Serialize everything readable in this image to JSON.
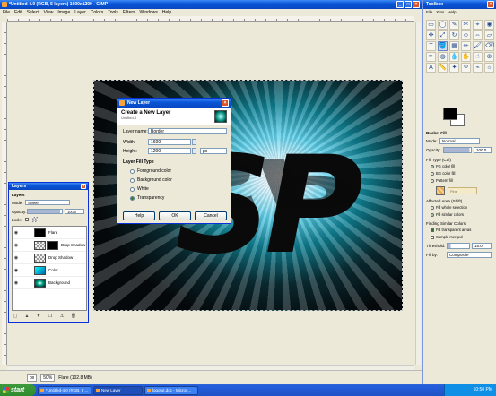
{
  "image_window": {
    "title": "*Untitled-4.0 (RGB, 5 layers) 1600x1200 - GIMP",
    "menu": [
      "File",
      "Edit",
      "Select",
      "View",
      "Image",
      "Layer",
      "Colors",
      "Tools",
      "Filters",
      "Windows",
      "Help"
    ],
    "status_unit": "px",
    "zoom": "50%",
    "status_text": "Flare (102.8 MB)"
  },
  "image": {
    "text": "SP"
  },
  "new_layer": {
    "title": "New Layer",
    "header": "Create a New Layer",
    "subheader": "Untitled-4",
    "layer_name_label": "Layer name:",
    "layer_name_value": "Border",
    "width_label": "Width:",
    "width_value": "1600",
    "height_label": "Height:",
    "height_value": "1200",
    "unit": "px",
    "fill_type_label": "Layer Fill Type",
    "fill_options": [
      "Foreground color",
      "Background color",
      "White",
      "Transparency"
    ],
    "selected_fill": 3,
    "help": "Help",
    "ok": "OK",
    "cancel": "Cancel"
  },
  "layers_dialog": {
    "title": "Layers",
    "section": "Layers",
    "mode_label": "Mode:",
    "mode_value": "Screen",
    "opacity_label": "Opacity:",
    "opacity_value": "100.0",
    "lock_label": "Lock:",
    "layers": [
      {
        "name": "Flare",
        "thumb": "#000000"
      },
      {
        "name": "Drop Shadow",
        "thumb": "#cccccc"
      },
      {
        "name": "Drop Shadow",
        "thumb": "#dddddd"
      },
      {
        "name": "Color",
        "thumb": "#20c0e0"
      },
      {
        "name": "Background",
        "thumb": "#0a3a40"
      }
    ]
  },
  "toolbox": {
    "title": "Toolbox",
    "menu": [
      "File",
      "Xtns",
      "Help"
    ],
    "tools": [
      "▭",
      "◯",
      "✎",
      "✂",
      "⌖",
      "◉",
      "✥",
      "⤢",
      "↻",
      "◇",
      "⇔",
      "▱",
      "T",
      "🪣",
      "▦",
      "✏",
      "🖌",
      "⌫",
      "✒",
      "◍",
      "💧",
      "✋",
      "☝",
      "⊕",
      "A",
      "📏",
      "✦",
      "⚲",
      "⌁",
      "☼"
    ],
    "active_tool": 13,
    "fg_color": "#000000",
    "bg_color": "#ffffff",
    "options_title": "Bucket Fill",
    "mode_label": "Mode:",
    "mode_value": "Normal",
    "opacity_label": "Opacity:",
    "opacity_value": "100.0",
    "fill_type_label": "Fill Type  (Ctrl)",
    "fill_types": [
      "FG color fill",
      "BG color fill",
      "Pattern fill"
    ],
    "selected_fill_type": 0,
    "pattern_name": "Pine",
    "affected_label": "Affected Area  (Shift)",
    "affected_options": [
      "Fill whole selection",
      "Fill similar colors"
    ],
    "selected_affected": 1,
    "finding_label": "Finding Similar Colors",
    "fill_transparent": "Fill transparent areas",
    "sample_merged": "Sample merged",
    "threshold_label": "Threshold:",
    "threshold_value": "15.0",
    "fill_by_label": "Fill by:",
    "fill_by_value": "Composite"
  },
  "taskbar": {
    "start": "start",
    "tasks": [
      "*Untitled-4.0 (RGB, 5 ...",
      "New Layer",
      "logotut.doc - Micros..."
    ],
    "active_task": 1,
    "clock": "10:50 PM"
  }
}
